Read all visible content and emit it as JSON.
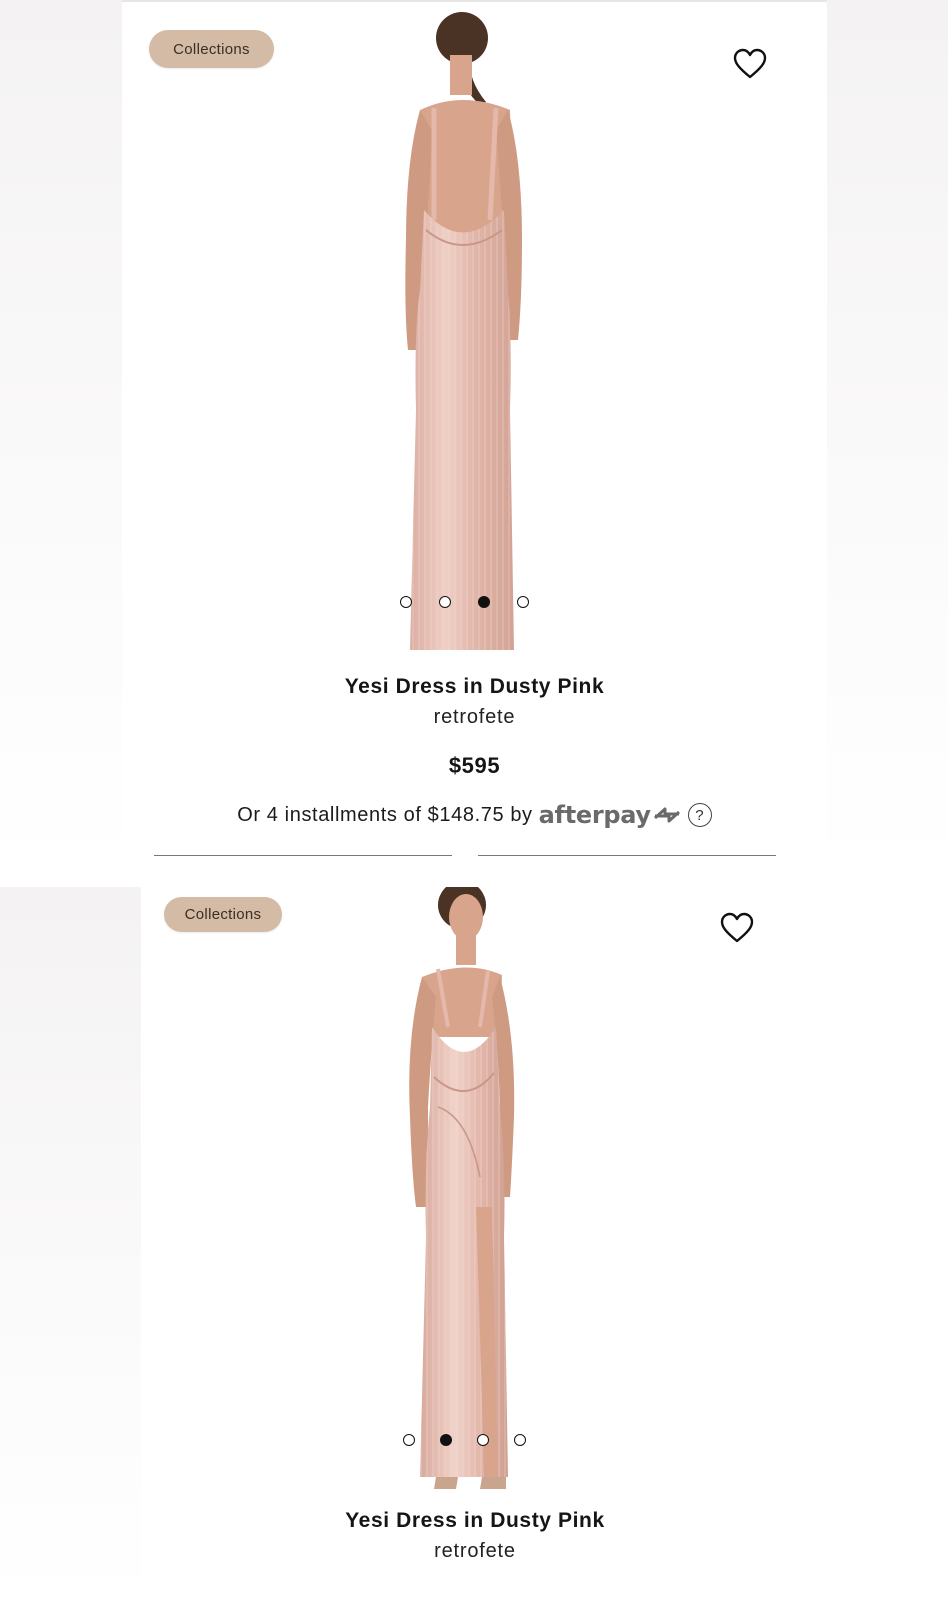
{
  "theme": {
    "badge_bg": "#d3bba5",
    "dress_color": "#e6bcb1",
    "skin_color": "#d8a48c",
    "hair_color": "#4a3224"
  },
  "listings": [
    {
      "badge_label": "Collections",
      "icons": {
        "wishlist": "heart-icon"
      },
      "image_view": "back",
      "carousel": {
        "count": 4,
        "active_index": 2
      },
      "title": "Yesi Dress in Dusty Pink",
      "brand": "retrofete",
      "price": "$595",
      "installments": {
        "text": "Or 4 installments of $148.75 by",
        "provider": "afterpay",
        "provider_icon": "afterpay-arrows-icon",
        "help_icon": "question-circle-icon"
      }
    },
    {
      "badge_label": "Collections",
      "icons": {
        "wishlist": "heart-icon"
      },
      "image_view": "side",
      "carousel": {
        "count": 4,
        "active_index": 1
      },
      "title": "Yesi Dress in Dusty Pink",
      "brand": "retrofete"
    }
  ]
}
